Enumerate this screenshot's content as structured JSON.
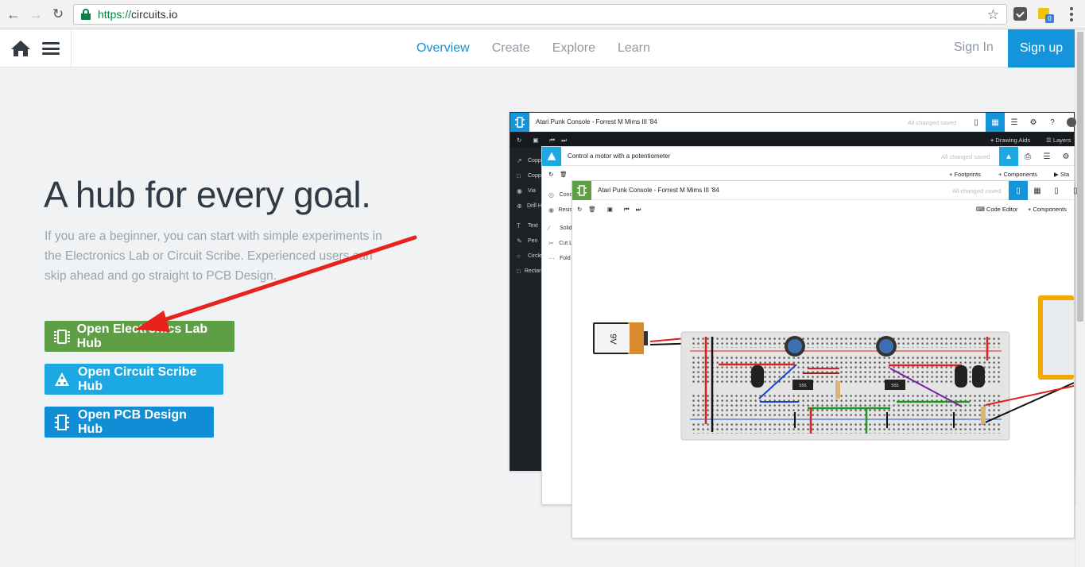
{
  "browser": {
    "url_scheme": "https://",
    "url_host": "circuits.io",
    "extension_badge": "0"
  },
  "header": {
    "nav": [
      "Overview",
      "Create",
      "Explore",
      "Learn"
    ],
    "active_nav": "Overview",
    "sign_in": "Sign In",
    "sign_up": "Sign up"
  },
  "hero": {
    "title": "A hub for every goal.",
    "description": "If you are a beginner, you can start with simple experiments in the Electronics Lab or Circuit Scribe. Experienced users can skip ahead and go straight to PCB Design.",
    "buttons": [
      {
        "label": "Open Electronics Lab Hub",
        "color": "#5e9e44",
        "icon": "chip-icon"
      },
      {
        "label": "Open Circuit Scribe Hub",
        "color": "#1ca8e3",
        "icon": "circuit-scribe-icon"
      },
      {
        "label": "Open PCB Design Hub",
        "color": "#0f8ed6",
        "icon": "pcb-icon"
      }
    ]
  },
  "preview": {
    "pcb_window": {
      "title": "Atari Punk Console - Forrest M Mims III '84",
      "status": "All changed saved",
      "drawing_aids": "Drawing Aids",
      "layers": "Layers",
      "side_tools": [
        "Copp",
        "Copp",
        "Via",
        "Drill H",
        "Text",
        "Pen",
        "Circle",
        "Rectan"
      ]
    },
    "scribe_window": {
      "title": "Control a motor with a potentiometer",
      "status": "All changed saved",
      "footprints": "Footprints",
      "components": "Components",
      "start": "Sta",
      "side_tools": [
        "Conc",
        "Resis",
        "Solid",
        "Cut L",
        "Fold"
      ]
    },
    "elab_window": {
      "title": "Atari Punk Console - Forrest M Mims III '84",
      "status": "All changed saved",
      "code_editor": "Code Editor",
      "components": "Components",
      "battery_label": "9V",
      "ic_label": "555"
    }
  },
  "colors": {
    "accent_blue": "#1494da",
    "elab_green": "#5e9e44",
    "arrow_red": "#e8231c"
  }
}
